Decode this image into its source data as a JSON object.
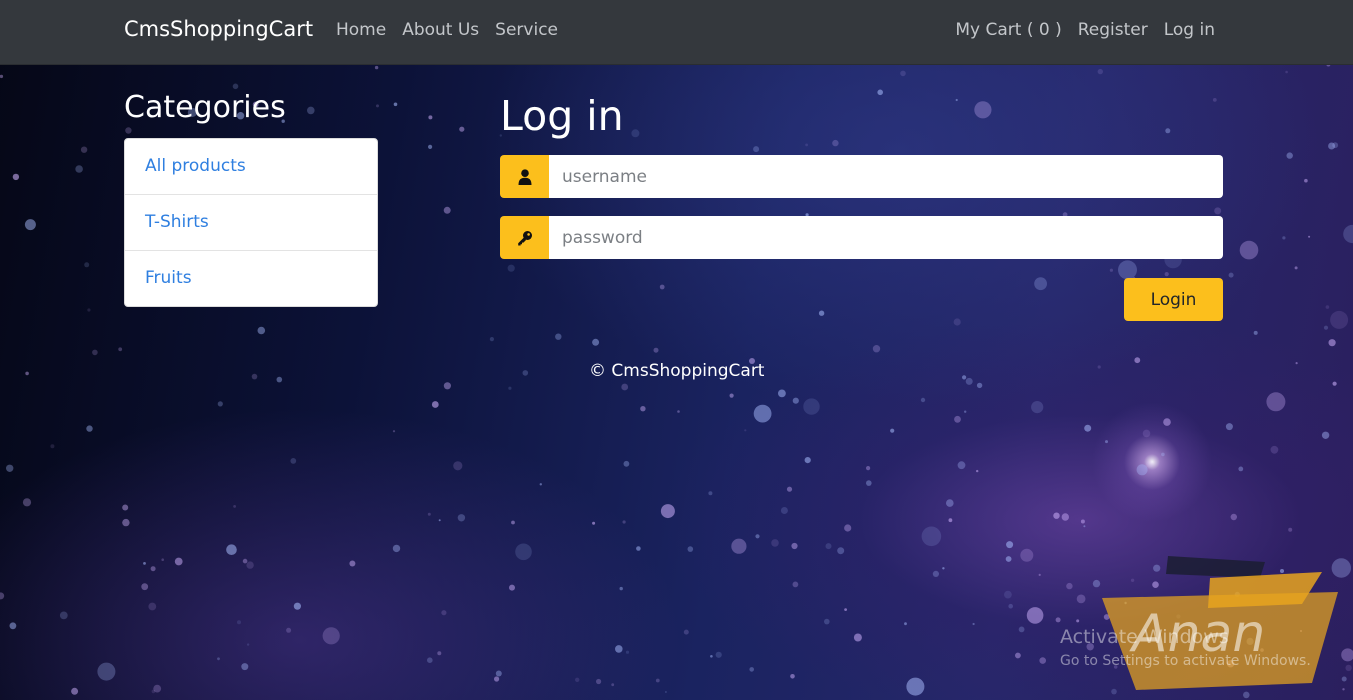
{
  "navbar": {
    "brand": "CmsShoppingCart",
    "left_links": [
      "Home",
      "About Us",
      "Service"
    ],
    "right_links": [
      "My Cart ( 0 )",
      "Register",
      "Log in"
    ]
  },
  "categories": {
    "title": "Categories",
    "items": [
      "All products",
      "T-Shirts",
      "Fruits"
    ]
  },
  "login": {
    "title": "Log in",
    "username_placeholder": "username",
    "username_value": "",
    "password_placeholder": "password",
    "password_value": "",
    "button_label": "Login"
  },
  "footer": {
    "text": "© CmsShoppingCart"
  },
  "overlay": {
    "watermark": "Anan",
    "activate_title": "Activate Windows",
    "activate_subtitle": "Go to Settings to activate Windows."
  },
  "icons": {
    "username": "user-icon",
    "password": "key-icon"
  },
  "colors": {
    "navbar_bg": "#34383d",
    "accent_yellow": "#fcbf1c",
    "link_blue": "#2f7fe0"
  }
}
